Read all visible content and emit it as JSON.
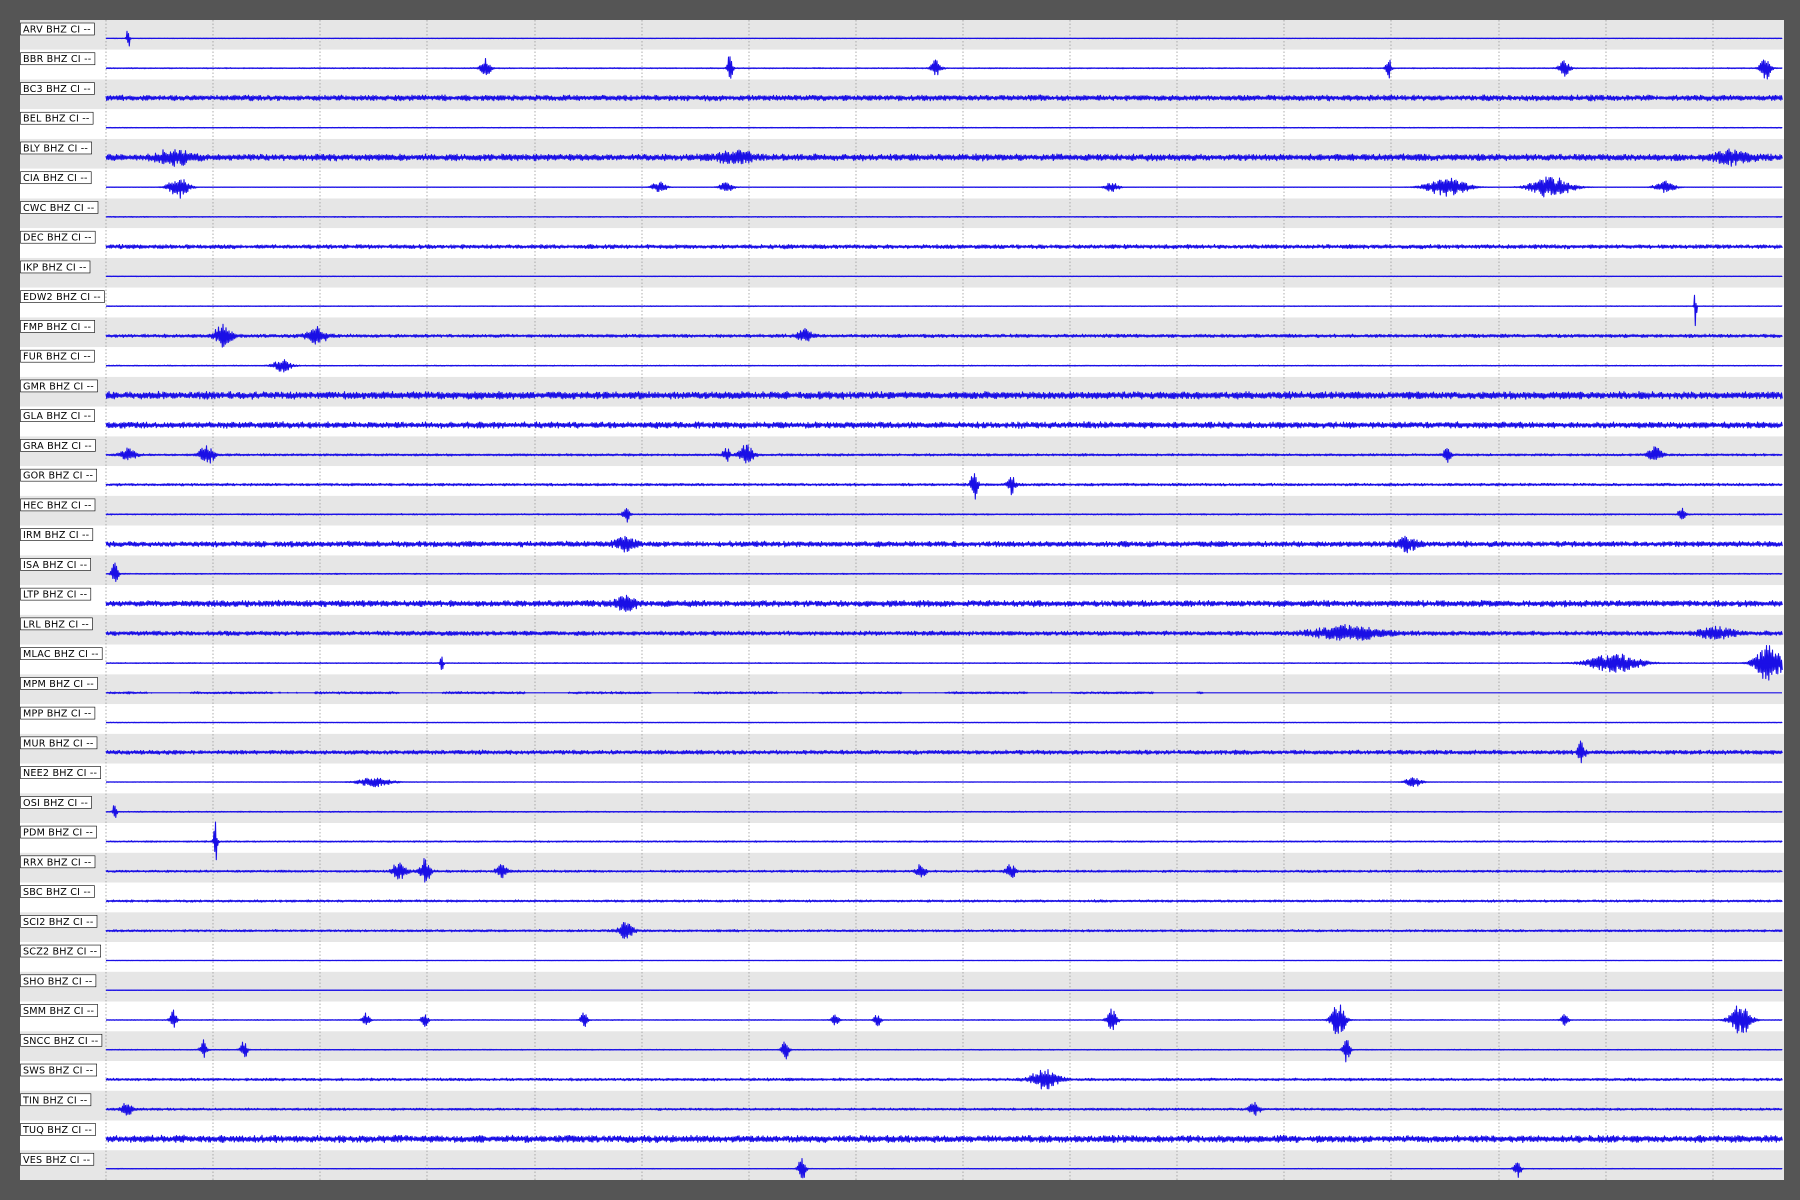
{
  "chart_data": {
    "type": "line",
    "title": "",
    "xlabel": "",
    "ylabel": "",
    "grid": true,
    "trace_color": "#1a0fe6",
    "band_colors": [
      "#e6e6e6",
      "#ffffff"
    ],
    "grid_color": "#9a9a9a",
    "traces": [
      {
        "label": "ARV BHZ CI --",
        "noise": 0.05,
        "events": [
          {
            "x": 0.013,
            "a": 5.5,
            "w": 0.0008
          }
        ]
      },
      {
        "label": "BBR BHZ CI --",
        "noise": 0.14,
        "events": [
          {
            "x": 0.226,
            "a": 3,
            "w": 0.003
          },
          {
            "x": 0.372,
            "a": 4,
            "w": 0.0015
          },
          {
            "x": 0.495,
            "a": 2.5,
            "w": 0.003
          },
          {
            "x": 0.765,
            "a": 4,
            "w": 0.0015
          },
          {
            "x": 0.87,
            "a": 2.5,
            "w": 0.003
          },
          {
            "x": 0.99,
            "a": 3.5,
            "w": 0.003
          }
        ]
      },
      {
        "label": "BC3 BHZ CI --",
        "noise": 0.75,
        "events": []
      },
      {
        "label": "BEL BHZ CI --",
        "noise": 0.1,
        "events": []
      },
      {
        "label": "BLY BHZ CI --",
        "noise": 0.9,
        "events": [
          {
            "x": 0.04,
            "a": 2,
            "w": 0.01
          },
          {
            "x": 0.375,
            "a": 1.8,
            "w": 0.01
          },
          {
            "x": 0.97,
            "a": 1.8,
            "w": 0.01
          }
        ]
      },
      {
        "label": "CIA BHZ CI --",
        "noise": 0.05,
        "events": [
          {
            "x": 0.043,
            "a": 3.5,
            "w": 0.006
          },
          {
            "x": 0.33,
            "a": 2,
            "w": 0.004
          },
          {
            "x": 0.37,
            "a": 1.5,
            "w": 0.004
          },
          {
            "x": 0.6,
            "a": 1.5,
            "w": 0.004
          },
          {
            "x": 0.8,
            "a": 3,
            "w": 0.012
          },
          {
            "x": 0.862,
            "a": 3.5,
            "w": 0.012
          },
          {
            "x": 0.93,
            "a": 2,
            "w": 0.006
          }
        ]
      },
      {
        "label": "CWC BHZ CI --",
        "noise": 0.12,
        "events": []
      },
      {
        "label": "DEC BHZ CI --",
        "noise": 0.55,
        "events": []
      },
      {
        "label": "IKP BHZ CI --",
        "noise": 0.07,
        "events": []
      },
      {
        "label": "EDW2 BHZ CI --",
        "noise": 0.1,
        "events": [
          {
            "x": 0.948,
            "a": 7,
            "w": 0.0006
          }
        ]
      },
      {
        "label": "FMP BHZ CI --",
        "noise": 0.45,
        "events": [
          {
            "x": 0.07,
            "a": 3.5,
            "w": 0.005
          },
          {
            "x": 0.125,
            "a": 2.5,
            "w": 0.006
          },
          {
            "x": 0.417,
            "a": 2,
            "w": 0.004
          }
        ]
      },
      {
        "label": "FUR BHZ CI --",
        "noise": 0.12,
        "events": [
          {
            "x": 0.105,
            "a": 2,
            "w": 0.005
          }
        ]
      },
      {
        "label": "GMR BHZ CI --",
        "noise": 1.0,
        "events": []
      },
      {
        "label": "GLA BHZ CI --",
        "noise": 0.85,
        "events": []
      },
      {
        "label": "GRA BHZ CI --",
        "noise": 0.3,
        "events": [
          {
            "x": 0.013,
            "a": 2,
            "w": 0.004
          },
          {
            "x": 0.06,
            "a": 3,
            "w": 0.004
          },
          {
            "x": 0.37,
            "a": 2.5,
            "w": 0.002
          },
          {
            "x": 0.382,
            "a": 3,
            "w": 0.004
          },
          {
            "x": 0.8,
            "a": 2,
            "w": 0.002
          },
          {
            "x": 0.924,
            "a": 2.5,
            "w": 0.004
          }
        ]
      },
      {
        "label": "GOR BHZ CI --",
        "noise": 0.35,
        "events": [
          {
            "x": 0.518,
            "a": 4.5,
            "w": 0.002
          },
          {
            "x": 0.54,
            "a": 3.5,
            "w": 0.002
          }
        ]
      },
      {
        "label": "HEC BHZ CI --",
        "noise": 0.18,
        "events": [
          {
            "x": 0.31,
            "a": 2.5,
            "w": 0.002
          },
          {
            "x": 0.94,
            "a": 2,
            "w": 0.002
          }
        ]
      },
      {
        "label": "IRM BHZ CI --",
        "noise": 0.75,
        "events": [
          {
            "x": 0.31,
            "a": 1.8,
            "w": 0.006
          },
          {
            "x": 0.776,
            "a": 1.8,
            "w": 0.006
          }
        ]
      },
      {
        "label": "ISA BHZ CI --",
        "noise": 0.15,
        "events": [
          {
            "x": 0.005,
            "a": 3.5,
            "w": 0.002
          }
        ]
      },
      {
        "label": "LTP BHZ CI --",
        "noise": 0.85,
        "events": [
          {
            "x": 0.31,
            "a": 1.8,
            "w": 0.006
          }
        ]
      },
      {
        "label": "LRL BHZ CI --",
        "noise": 0.6,
        "events": [
          {
            "x": 0.74,
            "a": 2,
            "w": 0.02
          },
          {
            "x": 0.96,
            "a": 1.8,
            "w": 0.01
          }
        ]
      },
      {
        "label": "MLAC BHZ CI --",
        "noise": 0.12,
        "events": [
          {
            "x": 0.2,
            "a": 2.5,
            "w": 0.001
          },
          {
            "x": 0.9,
            "a": 3,
            "w": 0.015
          },
          {
            "x": 0.992,
            "a": 6,
            "w": 0.008
          }
        ]
      },
      {
        "label": "MPM BHZ CI --",
        "noise": 0.3,
        "events": [],
        "gaps": true
      },
      {
        "label": "MPP BHZ CI --",
        "noise": 0.08,
        "events": []
      },
      {
        "label": "MUR BHZ CI --",
        "noise": 0.55,
        "events": [
          {
            "x": 0.88,
            "a": 3.5,
            "w": 0.002
          }
        ]
      },
      {
        "label": "NEE2 BHZ CI --",
        "noise": 0.06,
        "events": [
          {
            "x": 0.16,
            "a": 1.5,
            "w": 0.01
          },
          {
            "x": 0.78,
            "a": 1.5,
            "w": 0.005
          }
        ]
      },
      {
        "label": "OSI BHZ CI --",
        "noise": 0.15,
        "events": [
          {
            "x": 0.005,
            "a": 4,
            "w": 0.001
          }
        ]
      },
      {
        "label": "PDM BHZ CI --",
        "noise": 0.2,
        "events": [
          {
            "x": 0.065,
            "a": 7,
            "w": 0.001
          }
        ]
      },
      {
        "label": "RRX BHZ CI --",
        "noise": 0.3,
        "events": [
          {
            "x": 0.175,
            "a": 3,
            "w": 0.004
          },
          {
            "x": 0.19,
            "a": 4,
            "w": 0.003
          },
          {
            "x": 0.236,
            "a": 2.5,
            "w": 0.003
          },
          {
            "x": 0.486,
            "a": 2,
            "w": 0.003
          },
          {
            "x": 0.54,
            "a": 2,
            "w": 0.003
          }
        ]
      },
      {
        "label": "SBC BHZ CI --",
        "noise": 0.3,
        "events": []
      },
      {
        "label": "SCI2 BHZ CI --",
        "noise": 0.3,
        "events": [
          {
            "x": 0.31,
            "a": 3,
            "w": 0.004
          }
        ]
      },
      {
        "label": "SCZ2 BHZ CI --",
        "noise": 0.03,
        "events": []
      },
      {
        "label": "SHO BHZ CI --",
        "noise": 0.03,
        "events": []
      },
      {
        "label": "SMM BHZ CI --",
        "noise": 0.1,
        "events": [
          {
            "x": 0.04,
            "a": 3.5,
            "w": 0.002
          },
          {
            "x": 0.155,
            "a": 2.5,
            "w": 0.002
          },
          {
            "x": 0.19,
            "a": 2,
            "w": 0.002
          },
          {
            "x": 0.285,
            "a": 2.5,
            "w": 0.002
          },
          {
            "x": 0.435,
            "a": 2,
            "w": 0.002
          },
          {
            "x": 0.46,
            "a": 2,
            "w": 0.002
          },
          {
            "x": 0.6,
            "a": 3.5,
            "w": 0.003
          },
          {
            "x": 0.735,
            "a": 5.5,
            "w": 0.004
          },
          {
            "x": 0.87,
            "a": 2,
            "w": 0.002
          },
          {
            "x": 0.975,
            "a": 5,
            "w": 0.006
          }
        ]
      },
      {
        "label": "SNCC BHZ CI --",
        "noise": 0.12,
        "events": [
          {
            "x": 0.058,
            "a": 3,
            "w": 0.002
          },
          {
            "x": 0.082,
            "a": 3,
            "w": 0.002
          },
          {
            "x": 0.405,
            "a": 3,
            "w": 0.002
          },
          {
            "x": 0.74,
            "a": 4.5,
            "w": 0.002
          }
        ]
      },
      {
        "label": "SWS BHZ CI --",
        "noise": 0.35,
        "events": [
          {
            "x": 0.56,
            "a": 3,
            "w": 0.008
          }
        ]
      },
      {
        "label": "TIN BHZ CI --",
        "noise": 0.3,
        "events": [
          {
            "x": 0.012,
            "a": 2.5,
            "w": 0.003
          },
          {
            "x": 0.685,
            "a": 2,
            "w": 0.003
          }
        ]
      },
      {
        "label": "TUQ BHZ CI --",
        "noise": 0.95,
        "events": []
      },
      {
        "label": "VES BHZ CI --",
        "noise": 0.08,
        "events": [
          {
            "x": 0.415,
            "a": 4,
            "w": 0.002
          },
          {
            "x": 0.842,
            "a": 3,
            "w": 0.002
          }
        ]
      }
    ]
  }
}
